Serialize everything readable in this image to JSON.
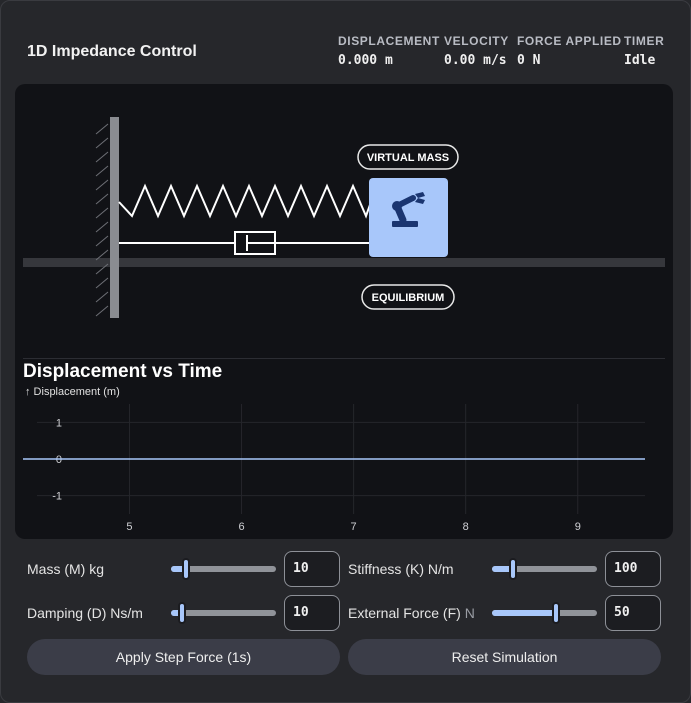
{
  "header": {
    "title": "1D Impedance Control",
    "stats": [
      {
        "label": "DISPLACEMENT",
        "value": "0.000 m"
      },
      {
        "label": "VELOCITY",
        "value": "0.00 m/s"
      },
      {
        "label": "FORCE APPLIED",
        "value": "0 N"
      },
      {
        "label": "TIMER",
        "value": "Idle"
      }
    ]
  },
  "scene": {
    "mass_label": "VIRTUAL MASS",
    "equilibrium_label": "EQUILIBRIUM",
    "mass_icon": "robot-arm-icon"
  },
  "chart": {
    "title": "Displacement vs Time",
    "ylabel": "↑ Displacement (m)",
    "y_ticks": [
      "1",
      "0",
      "-1"
    ],
    "x_ticks": [
      "5",
      "6",
      "7",
      "8",
      "9"
    ]
  },
  "chart_data": {
    "type": "line",
    "title": "Displacement vs Time",
    "ylabel": "Displacement (m)",
    "xlabel": "",
    "ylim": [
      -1.5,
      1.5
    ],
    "x_ticks": [
      5,
      6,
      7,
      8,
      9
    ],
    "xlim": [
      4.05,
      9.6
    ],
    "grid": true,
    "series": [
      {
        "x": [
          4.05,
          9.6
        ],
        "values": [
          0,
          0
        ]
      }
    ]
  },
  "controls": {
    "mass": {
      "label": "Mass (M) kg",
      "value": "10",
      "fraction": 0.14
    },
    "stiffness": {
      "label": "Stiffness (K) N/m",
      "value": "100",
      "fraction": 0.2
    },
    "damping": {
      "label": "Damping (D) Ns/m",
      "value": "10",
      "fraction": 0.1
    },
    "force": {
      "label": "External Force (F) ",
      "label_dim": "N",
      "value": "50",
      "fraction": 0.61
    }
  },
  "buttons": {
    "step": "Apply Step Force (1s)",
    "reset": "Reset Simulation"
  },
  "colors": {
    "accent": "#a8c7fa",
    "mass_block": "#a8c7fa",
    "icon": "#1a3570"
  }
}
